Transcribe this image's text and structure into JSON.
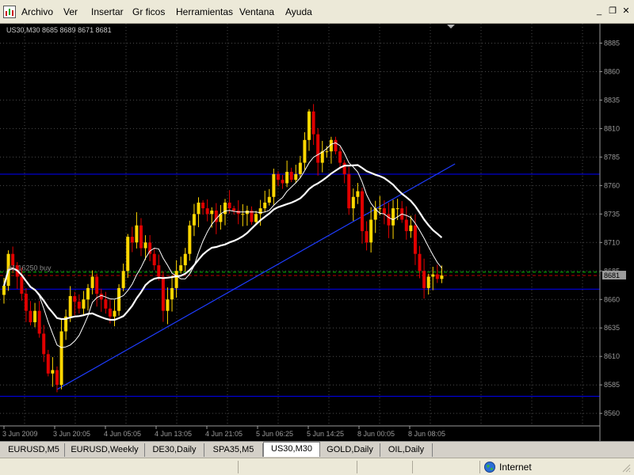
{
  "menu": {
    "items": [
      "Archivo",
      "Ver",
      "Insertar",
      "Gr ficos",
      "Herramientas",
      "Ventana",
      "Ayuda"
    ],
    "minimize_glyph": "_",
    "restore_glyph": "❐",
    "close_glyph": "✕"
  },
  "chart": {
    "header": "US30,M30  8685 8689 8671 8681",
    "order_label": "#1 16250 buy",
    "price_tag": "8681",
    "colors": {
      "background": "#000000",
      "bull": "#ffd700",
      "bear": "#e00000",
      "hline": "#0000ff",
      "trend": "#1e3cff",
      "ma": "#ffffff",
      "grid": "#4a4a4a",
      "bid": "#00c000",
      "ask": "#c00000"
    }
  },
  "chart_data": {
    "type": "candlestick",
    "y_ticks": [
      8560,
      8585,
      8610,
      8635,
      8660,
      8685,
      8710,
      8735,
      8760,
      8785,
      8810,
      8835,
      8860,
      8885
    ],
    "ylim": [
      8549,
      8902
    ],
    "x_ticks": [
      "3 Jun 2009",
      "3 Jun 20:05",
      "4 Jun 05:05",
      "4 Jun 13:05",
      "4 Jun 21:05",
      "5 Jun 06:25",
      "5 Jun 14:25",
      "8 Jun 00:05",
      "8 Jun 08:05"
    ],
    "closes": [
      8672,
      8700,
      8690,
      8680,
      8665,
      8650,
      8640,
      8650,
      8630,
      8612,
      8595,
      8598,
      8585,
      8632,
      8645,
      8663,
      8658,
      8652,
      8660,
      8670,
      8680,
      8665,
      8660,
      8652,
      8645,
      8650,
      8670,
      8685,
      8715,
      8710,
      8725,
      8705,
      8710,
      8700,
      8690,
      8680,
      8650,
      8660,
      8670,
      8685,
      8690,
      8700,
      8725,
      8735,
      8745,
      8740,
      8735,
      8738,
      8728,
      8735,
      8745,
      8740,
      8738,
      8735,
      8735,
      8738,
      8728,
      8735,
      8740,
      8745,
      8750,
      8770,
      8765,
      8762,
      8772,
      8765,
      8770,
      8780,
      8800,
      8825,
      8805,
      8780,
      8790,
      8790,
      8800,
      8790,
      8780,
      8770,
      8740,
      8750,
      8755,
      8720,
      8710,
      8730,
      8740,
      8740,
      8735,
      8725,
      8740,
      8740,
      8730,
      8720,
      8725,
      8700,
      8685,
      8670,
      8680,
      8682,
      8678,
      8681
    ],
    "hlines": [
      8770,
      8669,
      8575
    ],
    "bid_ask": [
      8681,
      8684
    ],
    "trendline": {
      "from": [
        12,
        8581
      ],
      "to": [
        102,
        8779
      ]
    },
    "ma_slow_window": 20,
    "ma_fast_window": 8
  },
  "tabs": [
    "EURUSD,M5",
    "EURUSD,Weekly",
    "DE30,Daily",
    "SPA35,M5",
    "US30,M30",
    "GOLD,Daily",
    "OIL,Daily"
  ],
  "active_tab": "US30,M30",
  "status": {
    "zone": "Internet"
  }
}
